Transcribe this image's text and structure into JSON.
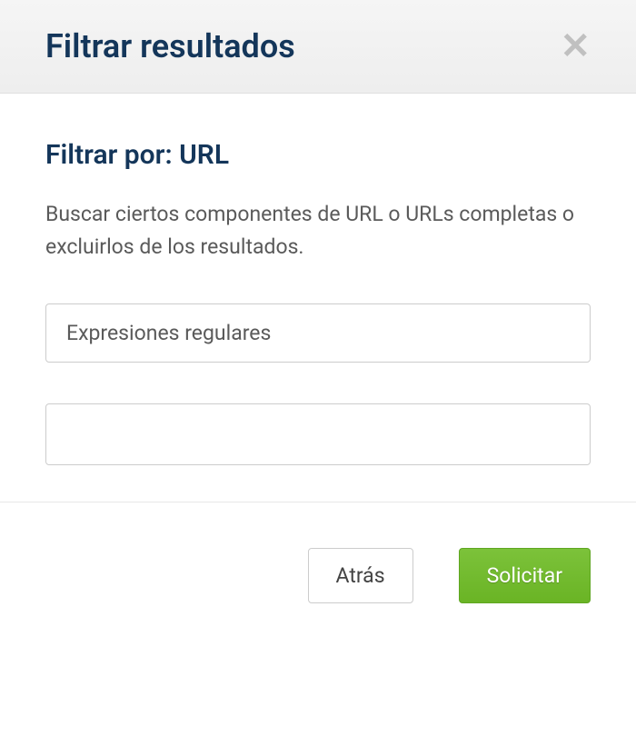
{
  "header": {
    "title": "Filtrar resultados"
  },
  "body": {
    "section_title": "Filtrar por: URL",
    "description": "Buscar ciertos componentes de URL o URLs completas o excluirlos de los resultados.",
    "select_value": "Expresiones regulares",
    "input_value": ""
  },
  "footer": {
    "back_label": "Atrás",
    "submit_label": "Solicitar"
  }
}
